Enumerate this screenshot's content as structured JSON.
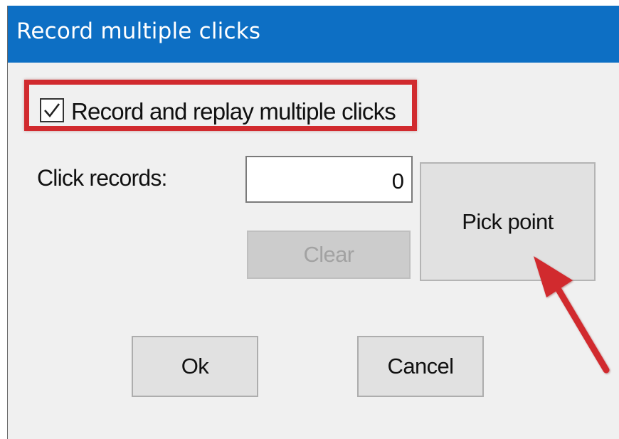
{
  "dialog": {
    "title": "Record multiple clicks",
    "title_bar_color": "#0d6fc4"
  },
  "checkbox": {
    "label": "Record and replay multiple clicks",
    "checked": true,
    "highlight_color": "#d12a2e"
  },
  "click_records": {
    "label": "Click records:",
    "value": "0"
  },
  "buttons": {
    "clear": {
      "label": "Clear",
      "enabled": false
    },
    "pick_point": {
      "label": "Pick point"
    },
    "ok": {
      "label": "Ok"
    },
    "cancel": {
      "label": "Cancel"
    }
  },
  "annotation": {
    "arrow_icon": "red-arrow-icon",
    "arrow_color": "#d12a2e"
  }
}
